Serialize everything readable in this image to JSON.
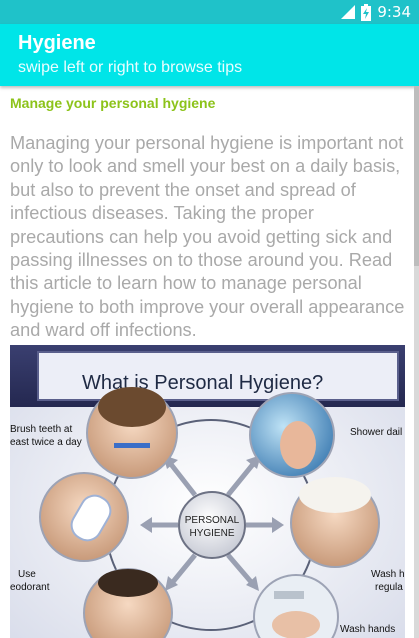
{
  "status_bar": {
    "time": "9:34",
    "battery_icon": "battery-charging-icon",
    "signal_icon": "signal-icon"
  },
  "app_bar": {
    "title": "Hygiene",
    "subtitle": "swipe left or right to browse tips"
  },
  "article": {
    "heading": "Manage your personal hygiene",
    "body": "Managing your personal hygiene is important not only to look and smell your best on a daily basis, but also to prevent the onset and spread of infectious diseases. Taking the proper precautions can help you avoid getting sick and passing illnesses on to those around you. Read this article to learn how to manage personal hygiene to both improve your overall appearance and ward off infections."
  },
  "figure": {
    "title": "What is Personal Hygiene?",
    "center_line1": "PERSONAL",
    "center_line2": "HYGIENE",
    "labels": {
      "brush_line1": "Brush teeth at",
      "brush_line2": "east twice a day",
      "shower": "Shower dail",
      "deodorant_line1": "Use",
      "deodorant_line2": "eodorant",
      "wash_line1": "Wash h",
      "wash_line2": "regula",
      "wash_hands": "Wash hands"
    }
  },
  "colors": {
    "status_bar": "#1fc2c9",
    "app_bar": "#00e5e8",
    "heading": "#8cc31a",
    "body_text": "#a9a9a9"
  }
}
